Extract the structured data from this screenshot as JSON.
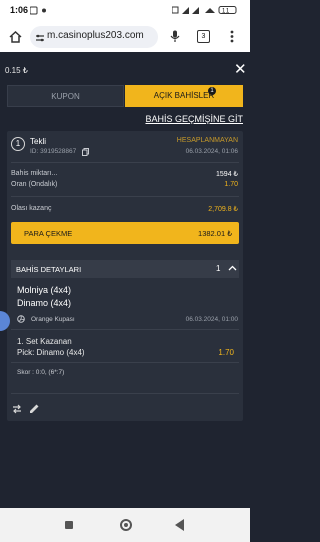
{
  "status_bar": {
    "time": "1:06",
    "icons": [
      "image-icon",
      "notification-dot",
      "vibrate-icon",
      "signal-icon",
      "wifi-icon",
      "battery-icon"
    ],
    "battery": "11"
  },
  "browser": {
    "url": "m.casinoplus203.com",
    "tab_count": "3"
  },
  "header": {
    "balance": "0.15 ₺"
  },
  "tabs": [
    {
      "label": "KUPON",
      "active": false
    },
    {
      "label": "AÇIK BAHİSLER",
      "active": true,
      "badge": "1"
    }
  ],
  "history_link": "BAHİS GEÇMİŞİNE GİT",
  "bet": {
    "number": "1",
    "type": "Tekli",
    "id": "ID: 3919528867",
    "status": "HESAPLANMAYAN",
    "date": "06.03.2024, 01:06",
    "stake_label": "Bahis miktarı...",
    "stake_value": "1594 ₺",
    "odds_label": "Oran (Ondalık)",
    "odds_value": "1.70",
    "potential_label": "Olası kazanç",
    "potential_value": "2,709.8 ₺",
    "cashout_label": "PARA ÇEKME",
    "cashout_value": "1382.01 ₺"
  },
  "details": {
    "header": "BAHİS DETAYLARI",
    "count": "1",
    "team1": "Molniya (4x4)",
    "team2": "Dinamo (4x4)",
    "league": "Orange Kupası",
    "event_date": "06.03.2024, 01:00",
    "market": "1. Set Kazanan",
    "pick": "Pick: Dinamo (4x4)",
    "pick_odds": "1.70",
    "score": "Skor : 0:0, (6*:7)"
  },
  "colors": {
    "background": "#1f2430",
    "card": "#2a303c",
    "accent": "#f1b51c",
    "status": "#c79a2a"
  }
}
